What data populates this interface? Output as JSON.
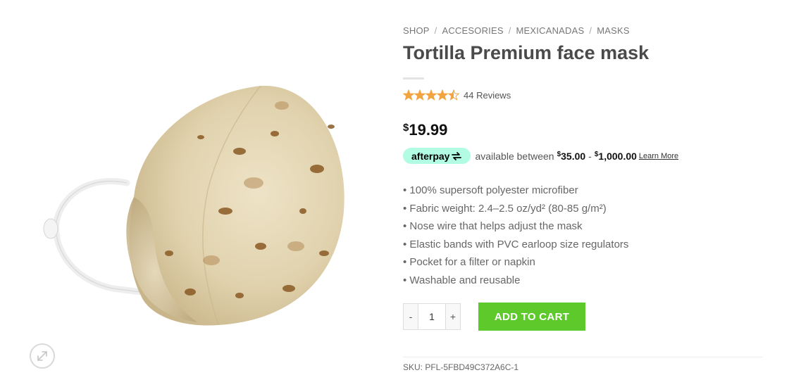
{
  "breadcrumb": [
    {
      "label": "SHOP"
    },
    {
      "label": "ACCESORIES"
    },
    {
      "label": "MEXICANADAS"
    },
    {
      "label": "MASKS"
    }
  ],
  "breadcrumb_separator": "/",
  "product": {
    "title": "Tortilla Premium face mask",
    "rating": 4.5,
    "rating_max": 5,
    "reviews_label": "44 Reviews",
    "price_currency": "$",
    "price_amount": "19.99"
  },
  "afterpay": {
    "logo_text": "afterpay",
    "text": "available between",
    "min_currency": "$",
    "min_amount": "35.00",
    "dash": "-",
    "max_currency": "$",
    "max_amount": "1,000.00",
    "learn_more": "Learn More"
  },
  "features": [
    "• 100% supersoft polyester microfiber",
    "• Fabric weight: 2.4–2.5 oz/yd² (80-85 g/m²)",
    "• Nose wire that helps adjust the mask",
    "• Elastic bands with PVC earloop size regulators",
    "• Pocket for a filter or napkin",
    "• Washable and reusable"
  ],
  "quantity": {
    "minus": "-",
    "value": "1",
    "plus": "+"
  },
  "add_to_cart": "ADD TO CART",
  "sku": "SKU: PFL-5FBD49C372A6C-1",
  "colors": {
    "star": "#f0a541",
    "add_to_cart": "#5dc92a",
    "afterpay": "#b2fce4",
    "title": "#4a4a4a"
  },
  "icons": {
    "zoom": "expand-arrows-icon",
    "star": "star-icon",
    "afterpay": "afterpay-arrows-icon"
  }
}
